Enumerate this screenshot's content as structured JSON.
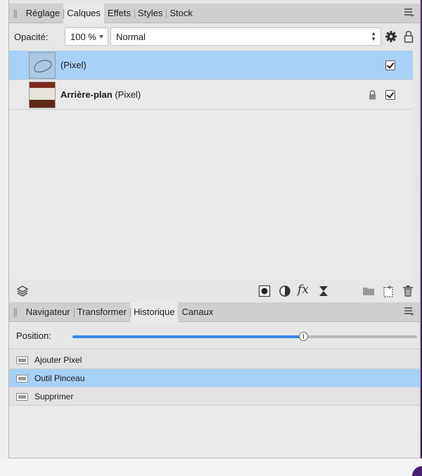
{
  "top_panel": {
    "tabs": [
      {
        "label": "Réglage",
        "active": false
      },
      {
        "label": "Calques",
        "active": true
      },
      {
        "label": "Effets",
        "active": false
      },
      {
        "label": "Styles",
        "active": false
      },
      {
        "label": "Stock",
        "active": false
      }
    ]
  },
  "opacity": {
    "label": "Opacité:",
    "value": "100 %",
    "blend_mode": "Normal"
  },
  "layers": [
    {
      "name_bold": "",
      "name": "(Pixel)",
      "selected": true,
      "locked": false,
      "visible": true
    },
    {
      "name_bold": "Arrière-plan",
      "name": " (Pixel)",
      "selected": false,
      "locked": true,
      "visible": true
    }
  ],
  "bottom_panel": {
    "tabs": [
      {
        "label": "Navigateur",
        "active": false
      },
      {
        "label": "Transformer",
        "active": false
      },
      {
        "label": "Historique",
        "active": true
      },
      {
        "label": "Canaux",
        "active": false
      }
    ]
  },
  "history": {
    "position_label": "Position:",
    "position_fraction": 0.67,
    "items": [
      {
        "label": "Ajouter Pixel",
        "selected": false
      },
      {
        "label": "Outil Pinceau",
        "selected": true
      },
      {
        "label": "Supprimer",
        "selected": false
      }
    ]
  },
  "colors": {
    "selection": "#a7d1f7",
    "slider_fill": "#3a86e8",
    "tabbar": "#cfcfcf"
  }
}
